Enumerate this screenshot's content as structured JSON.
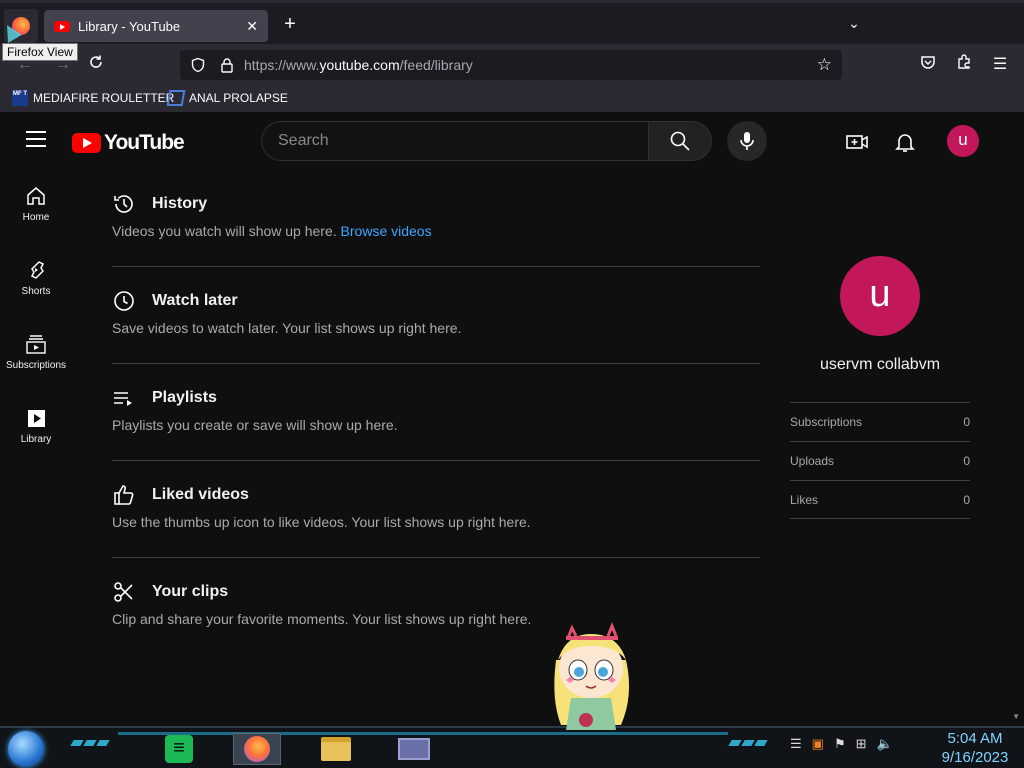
{
  "browser": {
    "tab_title": "Library - YouTube",
    "tooltip": "Firefox View",
    "url_prefix": "https://www.",
    "url_host": "youtube.com",
    "url_path": "/feed/library",
    "bookmarks": [
      {
        "label": "MEDIAFIRE ROULETTER",
        "icon_text": "MF T"
      },
      {
        "label": "ANAL PROLAPSE"
      }
    ]
  },
  "youtube": {
    "logo_text": "YouTube",
    "search_placeholder": "Search",
    "avatar_letter": "u",
    "guide": [
      {
        "label": "Home",
        "icon": "home-icon"
      },
      {
        "label": "Shorts",
        "icon": "shorts-icon"
      },
      {
        "label": "Subscriptions",
        "icon": "subscriptions-icon"
      },
      {
        "label": "Library",
        "icon": "library-icon"
      }
    ],
    "sections": [
      {
        "title": "History",
        "desc": "Videos you watch will show up here.",
        "link": "Browse videos",
        "icon": "history-icon"
      },
      {
        "title": "Watch later",
        "desc": "Save videos to watch later. Your list shows up right here.",
        "icon": "watch-later-icon"
      },
      {
        "title": "Playlists",
        "desc": "Playlists you create or save will show up here.",
        "icon": "playlist-icon"
      },
      {
        "title": "Liked videos",
        "desc": "Use the thumbs up icon to like videos. Your list shows up right here.",
        "icon": "thumbs-up-icon"
      },
      {
        "title": "Your clips",
        "desc": "Clip and share your favorite moments. Your list shows up right here.",
        "icon": "scissors-icon"
      }
    ],
    "profile": {
      "avatar_letter": "u",
      "name": "uservm collabvm",
      "stats": [
        {
          "label": "Subscriptions",
          "value": "0"
        },
        {
          "label": "Uploads",
          "value": "0"
        },
        {
          "label": "Likes",
          "value": "0"
        }
      ]
    }
  },
  "taskbar": {
    "time": "5:04 AM",
    "date": "9/16/2023"
  },
  "colors": {
    "accent_red": "#ff0000",
    "avatar_bg": "#c2185b",
    "link_blue": "#3ea6ff"
  }
}
